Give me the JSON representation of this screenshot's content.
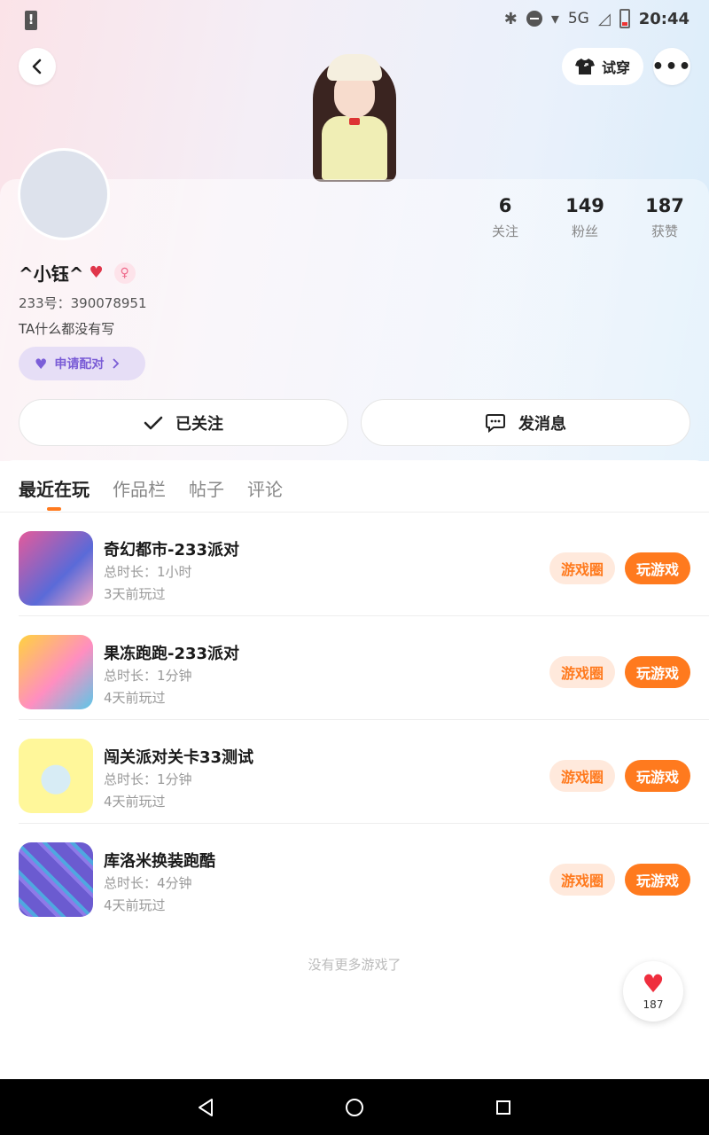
{
  "status_bar": {
    "time": "20:44",
    "network": "5G"
  },
  "header": {
    "tryon_label": "试穿",
    "more_label": "•••"
  },
  "profile": {
    "name": "^小钰^",
    "uid": "233号：390078951",
    "bio": "TA什么都没有写",
    "pair_label": "申请配对",
    "stats": [
      {
        "value": "6",
        "label": "关注"
      },
      {
        "value": "149",
        "label": "粉丝"
      },
      {
        "value": "187",
        "label": "获赞"
      }
    ],
    "follow_label": "已关注",
    "message_label": "发消息"
  },
  "tabs": [
    {
      "label": "最近在玩",
      "active": true
    },
    {
      "label": "作品栏",
      "active": false
    },
    {
      "label": "帖子",
      "active": false
    },
    {
      "label": "评论",
      "active": false
    }
  ],
  "games": [
    {
      "title": "奇幻都市-233派对",
      "duration": "总时长：1小时",
      "last_played": "3天前玩过",
      "circle_label": "游戏圈",
      "play_label": "玩游戏"
    },
    {
      "title": "果冻跑跑-233派对",
      "duration": "总时长：1分钟",
      "last_played": "4天前玩过",
      "circle_label": "游戏圈",
      "play_label": "玩游戏"
    },
    {
      "title": "闯关派对关卡33测试",
      "duration": "总时长：1分钟",
      "last_played": "4天前玩过",
      "circle_label": "游戏圈",
      "play_label": "玩游戏"
    },
    {
      "title": "库洛米换装跑酷",
      "duration": "总时长：4分钟",
      "last_played": "4天前玩过",
      "circle_label": "游戏圈",
      "play_label": "玩游戏"
    }
  ],
  "end_text": "没有更多游戏了",
  "like_fab": {
    "count": "187"
  },
  "colors": {
    "accent": "#ff7a1e",
    "accent_light": "#ffe9dc",
    "pair": "#7a5cd6"
  }
}
